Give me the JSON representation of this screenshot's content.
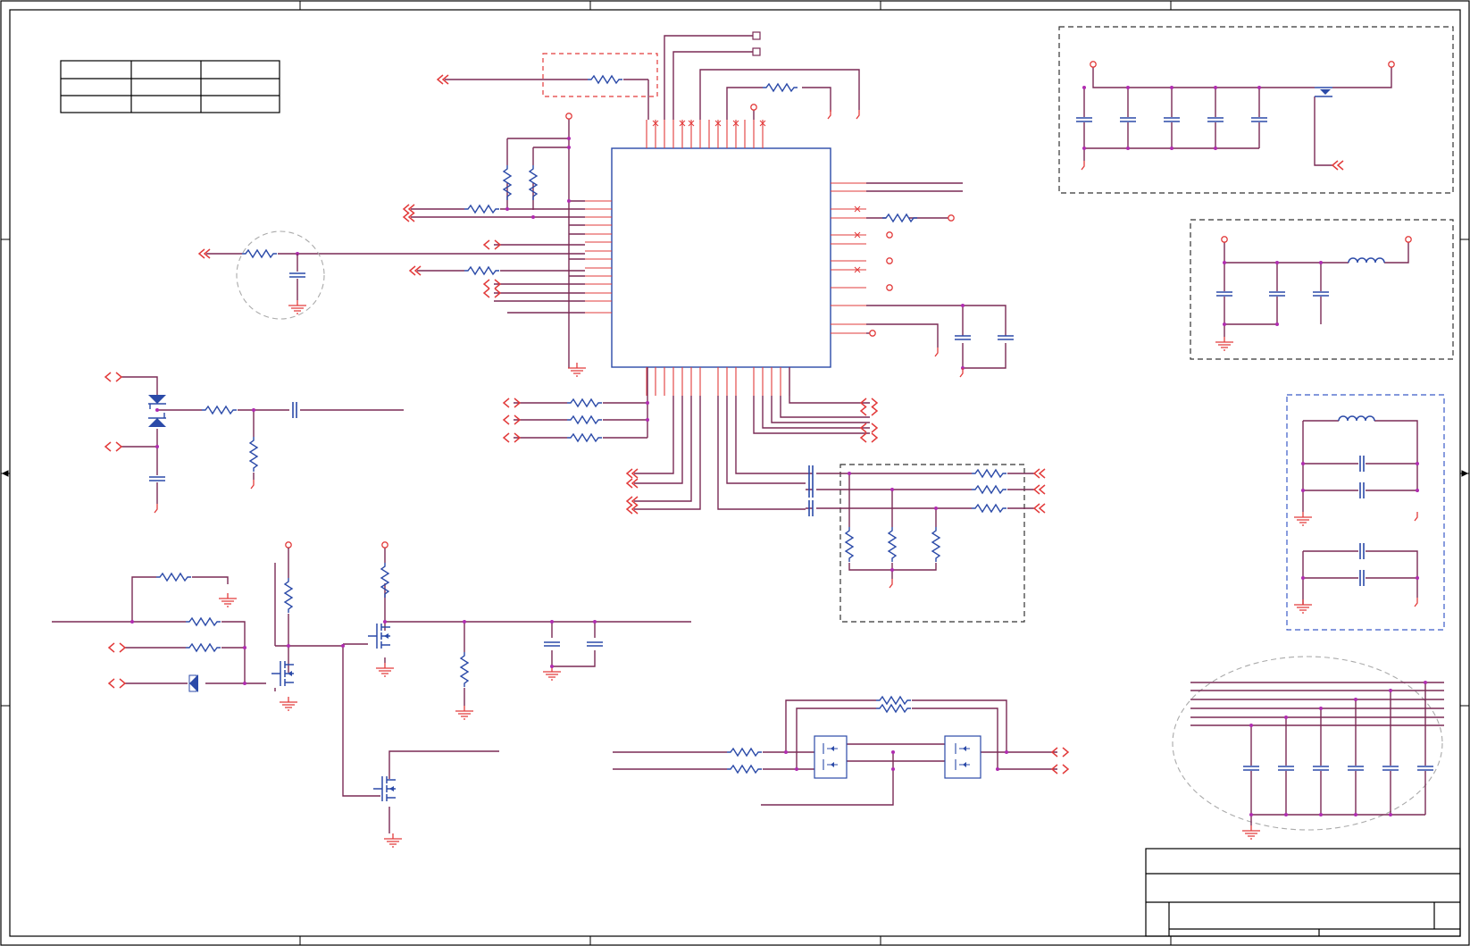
{
  "schematic": {
    "colors": {
      "wire": "#7a2a55",
      "pin": "#ff1a1a",
      "component": "#2b4aa8",
      "frame": "#000000",
      "block_red": "#e23b3b",
      "block_black": "#333333",
      "block_blue": "#3a5bc7",
      "group_gray": "#aaaaaa",
      "junction": "#b02cb0"
    },
    "labels": []
  }
}
